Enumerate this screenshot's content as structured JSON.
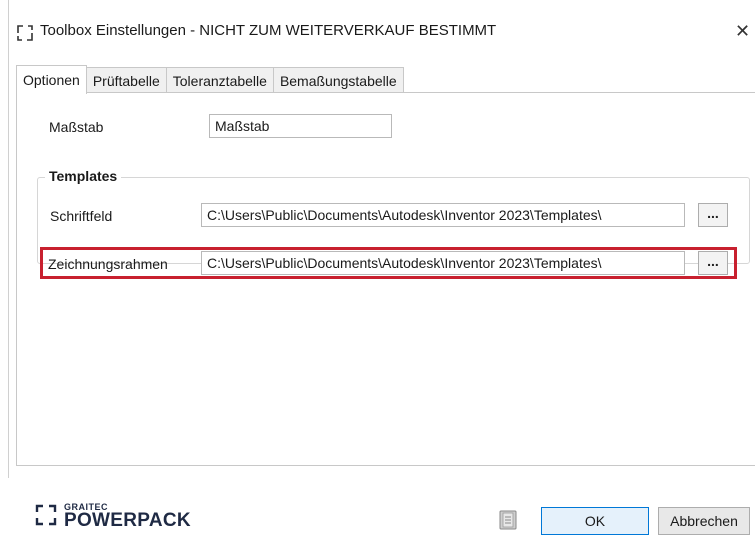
{
  "window": {
    "title": "Toolbox Einstellungen - NICHT ZUM WEITERVERKAUF BESTIMMT",
    "close_glyph": "✕"
  },
  "tabs": [
    {
      "label": "Optionen",
      "active": true
    },
    {
      "label": "Prüftabelle",
      "active": false
    },
    {
      "label": "Toleranztabelle",
      "active": false
    },
    {
      "label": "Bemaßungstabelle",
      "active": false
    }
  ],
  "options": {
    "massstab_label": "Maßstab",
    "massstab_value": "Maßstab",
    "templates": {
      "legend": "Templates",
      "schriftfeld_label": "Schriftfeld",
      "schriftfeld_value": "C:\\Users\\Public\\Documents\\Autodesk\\Inventor 2023\\Templates\\",
      "zeichnungsrahmen_label": "Zeichnungsrahmen",
      "zeichnungsrahmen_value": "C:\\Users\\Public\\Documents\\Autodesk\\Inventor 2023\\Templates\\",
      "browse_label": "..."
    }
  },
  "footer": {
    "logo_small": "GRAITEC",
    "logo_big": "POWERPACK",
    "ok_label": "OK",
    "cancel_label": "Abbrechen"
  },
  "icons": [
    "powerpack-bracket-icon",
    "help-book-icon",
    "close-icon",
    "graitec-logo-icon"
  ],
  "colors": {
    "highlight": "#c8202f",
    "ok_border": "#0078d7",
    "logo": "#1f2a44"
  }
}
